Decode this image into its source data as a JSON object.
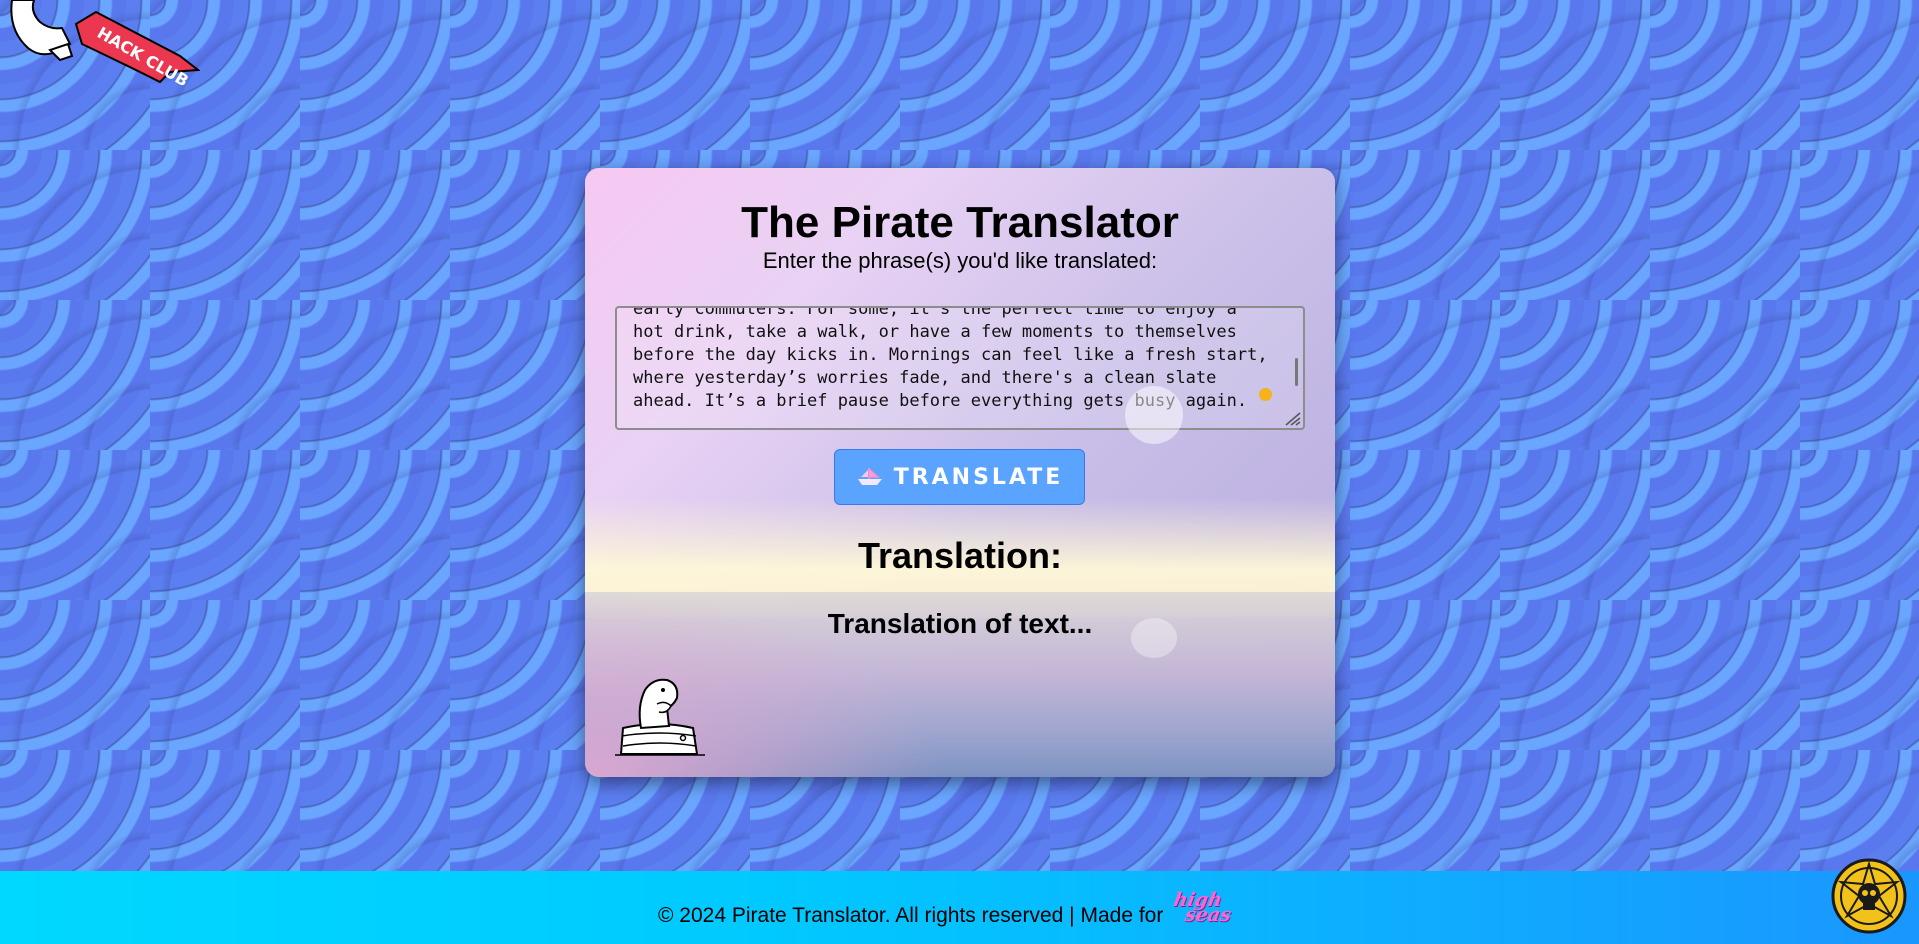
{
  "brand": {
    "hack_club_flag_text": "HACK CLUB"
  },
  "card": {
    "title": "The Pirate Translator",
    "subtitle": "Enter the phrase(s) you'd like translated:",
    "input_value": "early commuters. For some, it's the perfect time to enjoy a hot drink, take a walk, or have a few moments to themselves before the day kicks in. Mornings can feel like a fresh start, where yesterday’s worries fade, and there's a clean slate ahead. It’s a brief pause before everything gets busy again.",
    "translate_button_label": "TRANSLATE",
    "translation_heading": "Translation:",
    "translation_output": "Translation of text..."
  },
  "footer": {
    "copyright": "© 2024 Pirate Translator. All rights reserved | Made for",
    "high_seas_line1": "high",
    "high_seas_line2": "seas"
  },
  "icons": {
    "translate_button_icon": "ship-icon",
    "footer_badge": "skull-badge-icon",
    "card_illustration": "dinosaur-in-barrel"
  },
  "colors": {
    "button_bg": "#5aa3ff",
    "footer_start": "#00d8ff",
    "footer_end": "#1a96ff",
    "cursor_dot": "#f5b21b",
    "high_seas_pink": "#ff66cc"
  }
}
